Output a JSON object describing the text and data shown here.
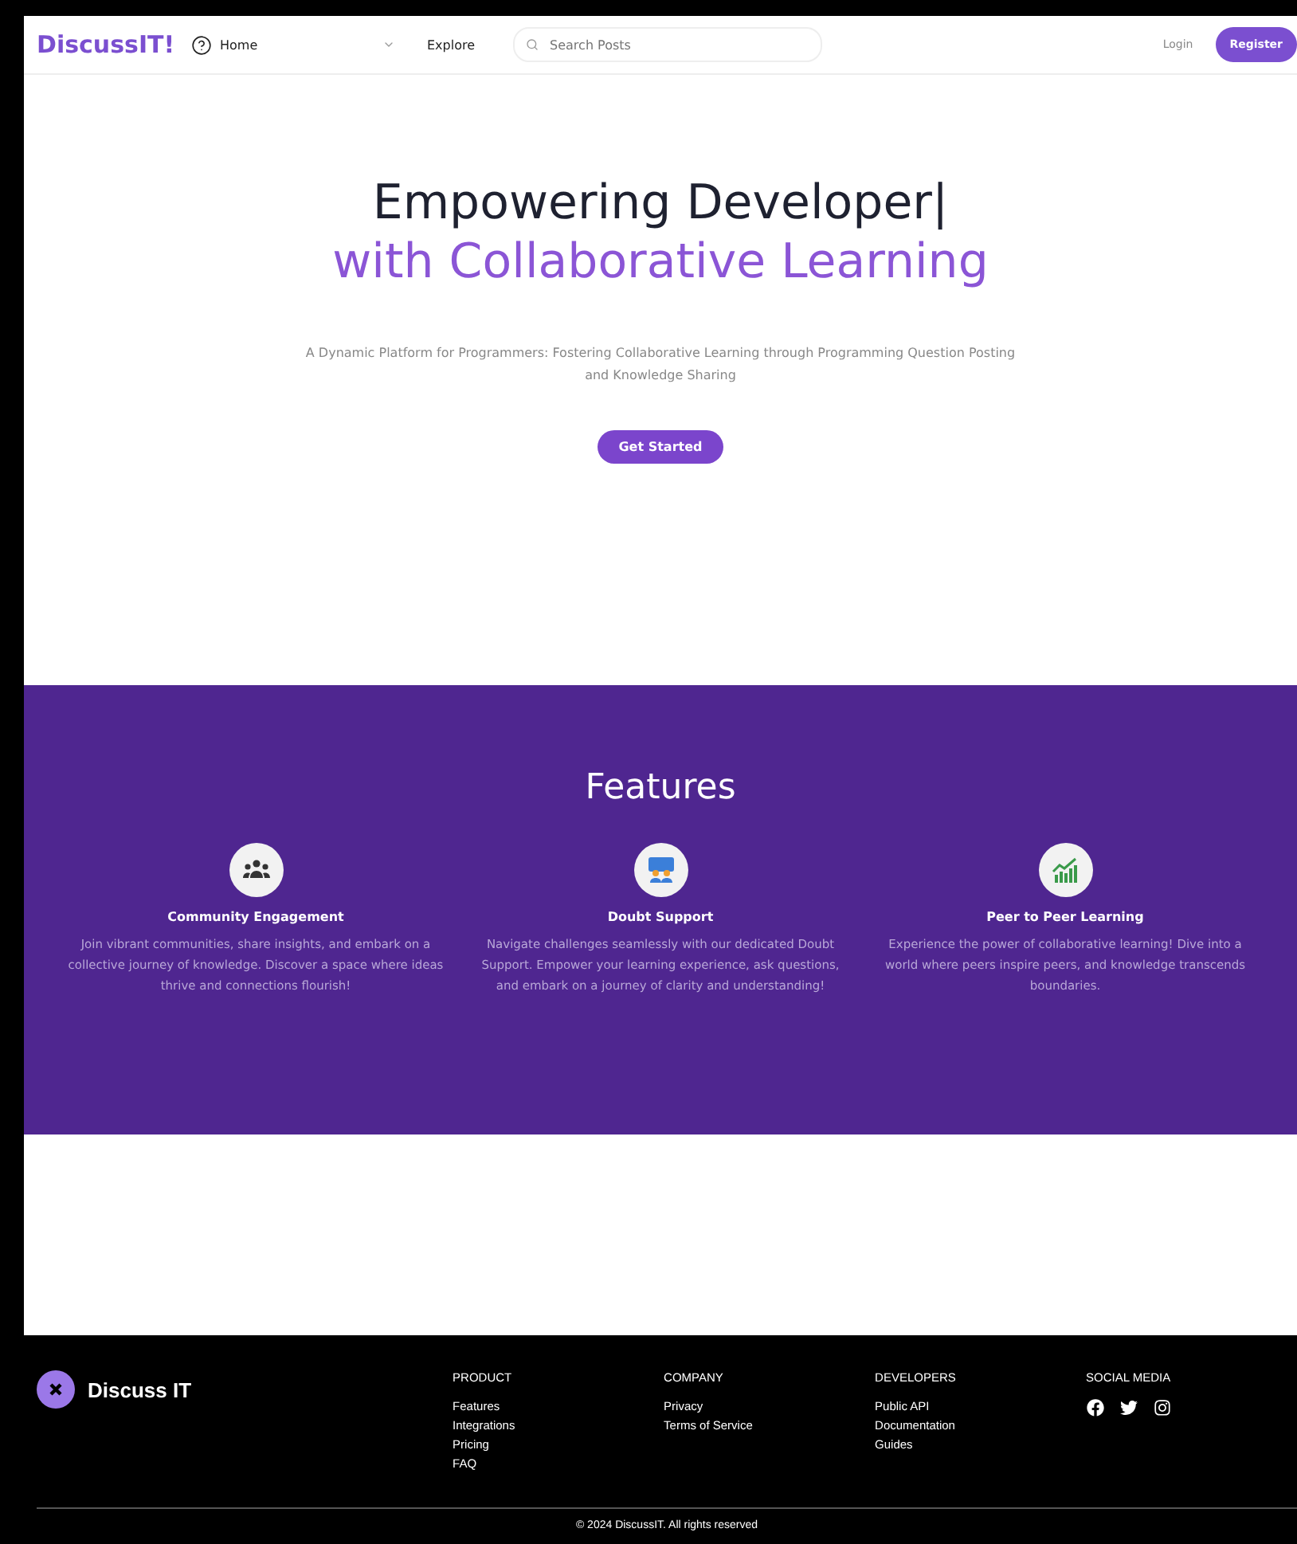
{
  "nav": {
    "logo": "DiscussIT!",
    "home": "Home",
    "explore": "Explore",
    "search": {
      "placeholder": "Search Posts"
    },
    "login": "Login",
    "register": "Register"
  },
  "hero": {
    "title_line1": "Empowering Developer|",
    "title_line2": "with Collaborative Learning",
    "subtitle": "A Dynamic Platform for Programmers: Fostering Collaborative Learning through Programming Question Posting and Knowledge Sharing",
    "cta": "Get Started"
  },
  "features": {
    "title": "Features",
    "items": [
      {
        "kind": "community",
        "title": "Community Engagement",
        "text": "Join vibrant communities, share insights, and embark on a collective journey of knowledge. Discover a space where ideas thrive and connections flourish!"
      },
      {
        "kind": "support",
        "title": "Doubt Support",
        "text": "Navigate challenges seamlessly with our dedicated Doubt Support. Empower your learning experience, ask questions, and embark on a journey of clarity and understanding!"
      },
      {
        "kind": "growth",
        "title": "Peer to Peer Learning",
        "text": "Experience the power of collaborative learning! Dive into a world where peers inspire peers, and knowledge transcends boundaries."
      }
    ]
  },
  "footer": {
    "brand": "Discuss IT",
    "columns": [
      {
        "heading": "PRODUCT",
        "links": [
          "Features",
          "Integrations",
          "Pricing",
          "FAQ"
        ]
      },
      {
        "heading": "COMPANY",
        "links": [
          "Privacy",
          "Terms of Service"
        ]
      },
      {
        "heading": "DEVELOPERS",
        "links": [
          "Public API",
          "Documentation",
          "Guides"
        ]
      }
    ],
    "social": {
      "heading": "SOCIAL MEDIA",
      "icons": [
        {
          "kind": "facebook"
        },
        {
          "kind": "twitter"
        },
        {
          "kind": "instagram"
        }
      ]
    },
    "copyright": "© 2024 DiscussIT. All rights reserved"
  }
}
